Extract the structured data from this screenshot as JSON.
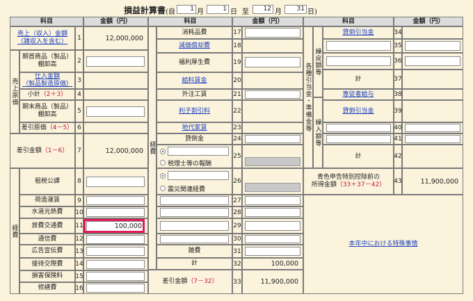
{
  "title": {
    "text": "損益計算書",
    "period_open": "(自",
    "from_month": "1",
    "month_label": "月",
    "from_day": "1",
    "day_label": "日",
    "to_label": "至",
    "to_month": "12",
    "to_day": "31",
    "period_close": "日)"
  },
  "headers": {
    "item": "科目",
    "amount": "金額（円）"
  },
  "col1": {
    "sales_l1": "売上（収入）金額",
    "sales_l2": "（雑収入を含む）",
    "sales_no": "1",
    "sales_val": "12,000,000",
    "cogs_group": "売上原価",
    "opening_l1": "期首商品（製品）",
    "opening_l2": "棚卸高",
    "opening_no": "2",
    "purch_l1": "仕入金額",
    "purch_l2": "（製品製造原価）",
    "purch_no": "3",
    "sub_label": "小計",
    "sub_formula": "（2＋3）",
    "sub_no": "4",
    "closing_l1": "期末商品（製品）",
    "closing_l2": "棚卸高",
    "closing_no": "5",
    "cogs_label": "差引原価",
    "cogs_formula": "（4－5）",
    "cogs_no": "6",
    "gross_label": "差引金額",
    "gross_formula": "（1－6）",
    "gross_no": "7",
    "gross_val": "12,000,000",
    "exp_group": "経費",
    "tax": "租税公課",
    "tax_no": "8",
    "freight": "荷造運賃",
    "freight_no": "9",
    "utilities": "水道光熱費",
    "utilities_no": "10",
    "travel": "旅費交通費",
    "travel_no": "11",
    "travel_val": "100,000",
    "comm": "通信費",
    "comm_no": "12",
    "adv": "広告宣伝費",
    "adv_no": "13",
    "ent": "接待交際費",
    "ent_no": "14",
    "ins": "損害保険料",
    "ins_no": "15",
    "repair": "修繕費",
    "repair_no": "16"
  },
  "col2": {
    "exp_group": "経費",
    "supplies": "消耗品費",
    "supplies_no": "17",
    "dep": "減価償却費",
    "dep_no": "18",
    "welfare": "福利厚生費",
    "welfare_no": "19",
    "salary": "給料賃金",
    "salary_no": "20",
    "outsource": "外注工賃",
    "outsource_no": "21",
    "interest": "利子割引料",
    "interest_no": "22",
    "rent": "地代家賃",
    "rent_no": "23",
    "baddebt": "貸倒金",
    "baddebt_no": "24",
    "tax_acc": "税理士等の報酬",
    "row25_no": "25",
    "disaster": "震災関連経費",
    "row26_no": "26",
    "row27_no": "27",
    "row28_no": "28",
    "row29_no": "29",
    "row30_no": "30",
    "misc": "雑費",
    "misc_no": "31",
    "total": "計",
    "total_no": "32",
    "total_val": "100,000",
    "net_label": "差引金額",
    "net_formula": "（7－32）",
    "net_no": "33",
    "net_val": "11,900,000"
  },
  "col3": {
    "group_main": "各種引当金・準備金等",
    "group_out": "繰戻額等",
    "group_in": "繰入額等",
    "dep_reserve": "貸倒引当金",
    "row34_no": "34",
    "row35_no": "35",
    "row36_no": "36",
    "sum1": "計",
    "row37_no": "37",
    "family_salary": "専従者給与",
    "row38_no": "38",
    "dep_reserve2": "貸倒引当金",
    "row39_no": "39",
    "row40_no": "40",
    "row41_no": "41",
    "sum2": "計",
    "row42_no": "42",
    "blue_l1": "青色申告特別控除前の",
    "blue_l2": "所得金額",
    "blue_formula": "（33＋37－42）",
    "row43_no": "43",
    "row43_val": "11,900,000",
    "special": "本年中における特殊事情"
  }
}
